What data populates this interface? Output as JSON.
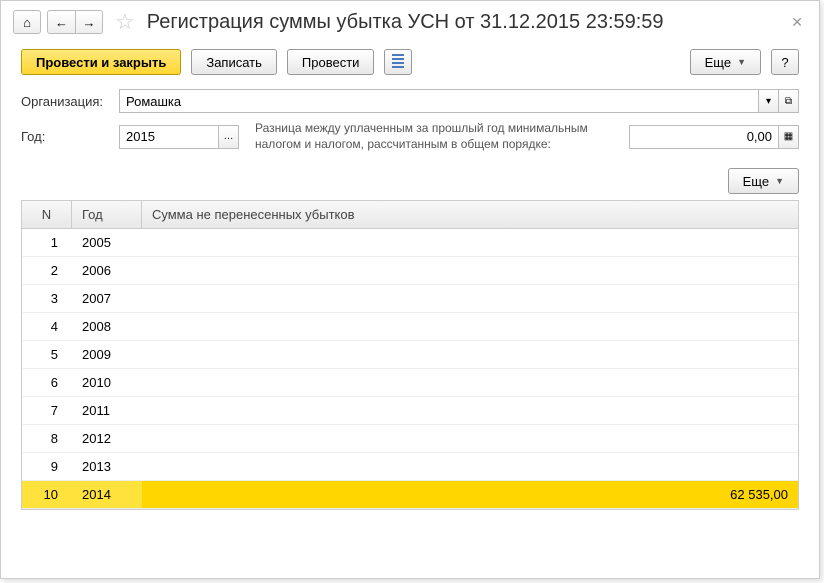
{
  "title": "Регистрация суммы убытка УСН от 31.12.2015 23:59:59",
  "toolbar": {
    "post_close": "Провести и закрыть",
    "save": "Записать",
    "post": "Провести",
    "more": "Еще",
    "help": "?"
  },
  "form": {
    "org_label": "Организация:",
    "org_value": "Ромашка",
    "year_label": "Год:",
    "year_value": "2015",
    "diff_label": "Разница между уплаченным за прошлый год минимальным налогом и налогом, рассчитанным в общем порядке:",
    "diff_value": "0,00"
  },
  "sub_toolbar": {
    "more": "Еще"
  },
  "grid": {
    "headers": {
      "n": "N",
      "year": "Год",
      "sum": "Сумма не перенесенных убытков"
    },
    "rows": [
      {
        "n": "1",
        "year": "2005",
        "sum": ""
      },
      {
        "n": "2",
        "year": "2006",
        "sum": ""
      },
      {
        "n": "3",
        "year": "2007",
        "sum": ""
      },
      {
        "n": "4",
        "year": "2008",
        "sum": ""
      },
      {
        "n": "5",
        "year": "2009",
        "sum": ""
      },
      {
        "n": "6",
        "year": "2010",
        "sum": ""
      },
      {
        "n": "7",
        "year": "2011",
        "sum": ""
      },
      {
        "n": "8",
        "year": "2012",
        "sum": ""
      },
      {
        "n": "9",
        "year": "2013",
        "sum": ""
      },
      {
        "n": "10",
        "year": "2014",
        "sum": "62 535,00",
        "selected": true
      }
    ]
  }
}
